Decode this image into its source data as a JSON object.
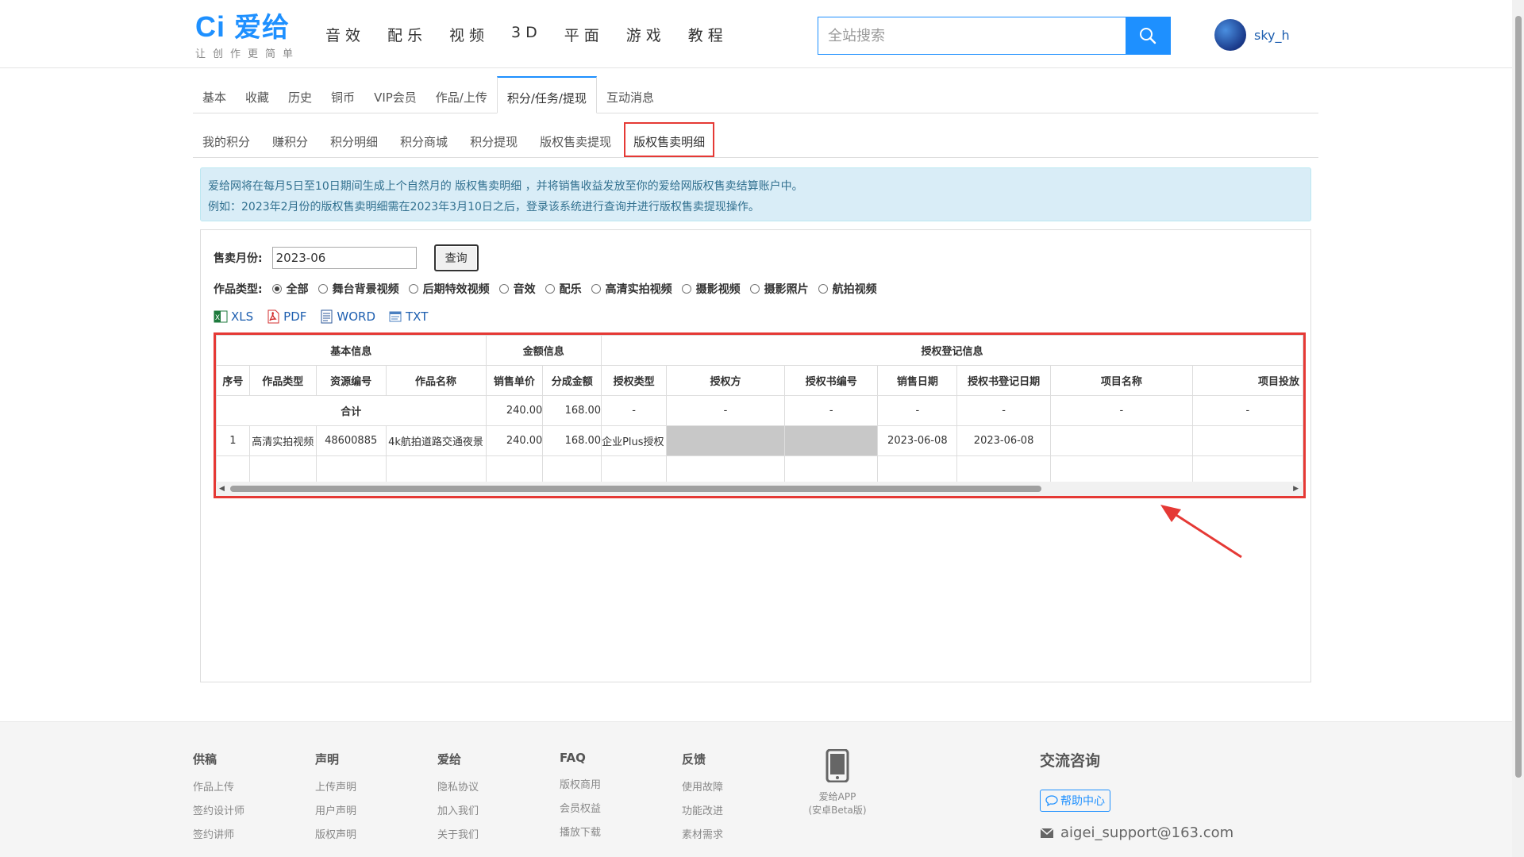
{
  "header": {
    "logo_text": "爱给",
    "logo_mark": "Ci",
    "logo_slogan": "让创作更简单",
    "nav": [
      "音效",
      "配乐",
      "视频",
      "3D",
      "平面",
      "游戏",
      "教程"
    ],
    "search_placeholder": "全站搜索",
    "username": "sky_h"
  },
  "tabs_primary": [
    "基本",
    "收藏",
    "历史",
    "铜币",
    "VIP会员",
    "作品/上传",
    "积分/任务/提现",
    "互动消息"
  ],
  "tabs_primary_active": 6,
  "tabs_secondary": [
    "我的积分",
    "赚积分",
    "积分明细",
    "积分商城",
    "积分提现",
    "版权售卖提现",
    "版权售卖明细"
  ],
  "tabs_secondary_active": 6,
  "notice": {
    "line1": "爱给网将在每月5日至10日期间生成上个自然月的 版权售卖明细 ，并将销售收益发放至你的爱给网版权售卖结算账户中。",
    "line2": "例如：2023年2月份的版权售卖明细需在2023年3月10日之后，登录该系统进行查询并进行版权售卖提现操作。"
  },
  "filter": {
    "month_label": "售卖月份:",
    "month_value": "2023-06",
    "query_button": "查询",
    "type_label": "作品类型:",
    "types": [
      "全部",
      "舞台背景视频",
      "后期特效视频",
      "音效",
      "配乐",
      "高清实拍视频",
      "摄影视频",
      "摄影照片",
      "航拍视频"
    ],
    "selected_type": 0
  },
  "exports": [
    {
      "label": "XLS",
      "icon": "excel-icon",
      "color": "#1d7a3c"
    },
    {
      "label": "PDF",
      "icon": "pdf-icon",
      "color": "#d32f2f"
    },
    {
      "label": "WORD",
      "icon": "word-icon",
      "color": "#2b579a"
    },
    {
      "label": "TXT",
      "icon": "txt-icon",
      "color": "#4a7fc0"
    }
  ],
  "table": {
    "groups": [
      "基本信息",
      "金额信息",
      "授权登记信息"
    ],
    "columns": [
      "序号",
      "作品类型",
      "资源编号",
      "作品名称",
      "销售单价",
      "分成金额",
      "授权类型",
      "授权方",
      "授权书编号",
      "销售日期",
      "授权书登记日期",
      "项目名称",
      "项目投放"
    ],
    "total_row": {
      "label": "合计",
      "unit_price": "240.00",
      "share": "168.00",
      "auth_type": "-",
      "licensor": "-",
      "cert_no": "-",
      "sale_date": "-",
      "reg_date": "-",
      "project": "-",
      "placement": "-"
    },
    "rows": [
      {
        "no": "1",
        "type": "高清实拍视频",
        "id": "48600885",
        "name": "4k航拍道路交通夜景",
        "unit_price": "240.00",
        "share": "168.00",
        "auth_type": "企业Plus授权",
        "licensor": "",
        "cert_no": "",
        "sale_date": "2023-06-08",
        "reg_date": "2023-06-08",
        "project": "",
        "placement": ""
      }
    ]
  },
  "footer": {
    "columns": [
      {
        "head": "供稿",
        "links": [
          "作品上传",
          "签约设计师",
          "签约讲师"
        ]
      },
      {
        "head": "声明",
        "links": [
          "上传声明",
          "用户声明",
          "版权声明"
        ]
      },
      {
        "head": "爱给",
        "links": [
          "隐私协议",
          "加入我们",
          "关于我们"
        ]
      },
      {
        "head": "FAQ",
        "links": [
          "版权商用",
          "会员权益",
          "播放下载"
        ]
      },
      {
        "head": "反馈",
        "links": [
          "使用故障",
          "功能改进",
          "素材需求"
        ]
      }
    ],
    "app_line1": "爱给APP",
    "app_line2": "(安卓Beta版)",
    "contact_title": "交流咨询",
    "help_center": "帮助中心",
    "email": "aigei_support@163.com"
  },
  "colors": {
    "brand": "#1e90ff",
    "highlight": "#e53935",
    "notice_bg": "#d9edf7"
  }
}
